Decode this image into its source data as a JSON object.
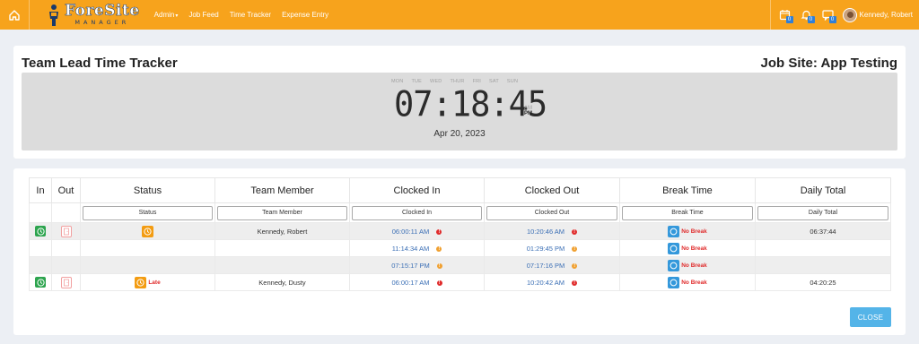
{
  "nav": {
    "logo_main": "ForeSite",
    "logo_sub": "MANAGER",
    "items": [
      "Admin",
      "Job Feed",
      "Time Tracker",
      "Expense Entry"
    ],
    "user_name": "Kennedy, Robert",
    "badges": {
      "calendar": "0",
      "bell": "0",
      "chat": "0"
    }
  },
  "header": {
    "title": "Team Lead Time Tracker",
    "job_site": "Job Site: App Testing"
  },
  "clock": {
    "days": [
      "MON",
      "TUE",
      "WED",
      "THUR",
      "FRI",
      "SAT",
      "SUN"
    ],
    "time": "07:18:45",
    "am": "AM",
    "pm": "PM",
    "date": "Apr 20, 2023"
  },
  "table": {
    "headers": [
      "In",
      "Out",
      "Status",
      "Team Member",
      "Clocked In",
      "Clocked Out",
      "Break Time",
      "Daily Total"
    ],
    "filters": [
      "Status",
      "Team Member",
      "Clocked In",
      "Clocked Out",
      "Break Time",
      "Daily Total"
    ],
    "rows": [
      {
        "member": "Kennedy, Robert",
        "clocked_in": "06:00:11 AM",
        "clocked_out": "10:20:46 AM",
        "break": "No Break",
        "total": "06:37:44",
        "status": ""
      },
      {
        "member": "",
        "clocked_in": "11:14:34 AM",
        "clocked_out": "01:29:45 PM",
        "break": "No Break",
        "total": "",
        "status": ""
      },
      {
        "member": "",
        "clocked_in": "07:15:17 PM",
        "clocked_out": "07:17:16 PM",
        "break": "No Break",
        "total": "",
        "status": ""
      },
      {
        "member": "Kennedy, Dusty",
        "clocked_in": "06:00:17 AM",
        "clocked_out": "10:20:42 AM",
        "break": "No Break",
        "total": "04:20:25",
        "status": "Late"
      }
    ]
  },
  "close_label": "CLOSE",
  "colors": {
    "topbar": "#f7a31c",
    "clock_in": "#2da44e",
    "status": "#f39c12",
    "break": "#3498db",
    "alert": "#e02b2b",
    "close": "#54b4e8"
  }
}
